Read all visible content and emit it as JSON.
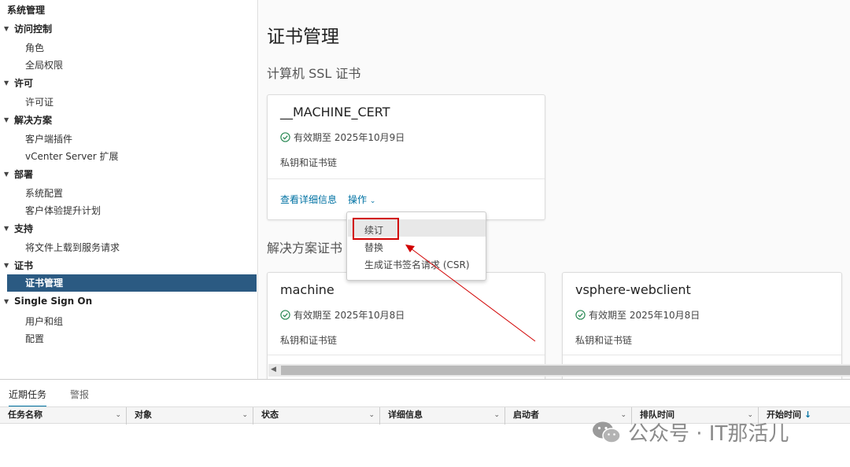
{
  "sidebar": {
    "root": "系统管理",
    "groups": [
      {
        "label": "访问控制",
        "items": [
          "角色",
          "全局权限"
        ]
      },
      {
        "label": "许可",
        "items": [
          "许可证"
        ]
      },
      {
        "label": "解决方案",
        "items": [
          "客户端插件",
          "vCenter Server 扩展"
        ]
      },
      {
        "label": "部署",
        "items": [
          "系统配置",
          "客户体验提升计划"
        ]
      },
      {
        "label": "支持",
        "items": [
          "将文件上载到服务请求"
        ]
      },
      {
        "label": "证书",
        "items": [
          "证书管理"
        ]
      },
      {
        "label": "Single Sign On",
        "items": [
          "用户和组",
          "配置"
        ]
      }
    ],
    "active_item": "证书管理"
  },
  "main": {
    "title": "证书管理",
    "machine_section": "计算机 SSL 证书",
    "solution_section": "解决方案证书",
    "machine_card": {
      "name": "__MACHINE_CERT",
      "status": "有效期至 2025年10月9日",
      "sub": "私钥和证书链",
      "details_link": "查看详细信息",
      "actions_link": "操作"
    },
    "solution_cards": [
      {
        "name": "machine",
        "status": "有效期至 2025年10月8日",
        "sub": "私钥和证书链"
      },
      {
        "name": "vsphere-webclient",
        "status": "有效期至 2025年10月8日",
        "sub": "私钥和证书链"
      }
    ]
  },
  "dropdown": {
    "options": [
      "续订",
      "替换",
      "生成证书签名请求 (CSR)"
    ]
  },
  "bottom": {
    "tabs": [
      "近期任务",
      "警报"
    ],
    "columns": [
      "任务名称",
      "对象",
      "状态",
      "详细信息",
      "启动者",
      "排队时间",
      "开始时间"
    ],
    "sort_indicator": "↓"
  },
  "watermark": "公众号 · IT那活儿",
  "colors": {
    "accent": "#0072a3",
    "active_nav": "#2b5a82",
    "success": "#2e8b57",
    "annotation": "#d10000"
  }
}
